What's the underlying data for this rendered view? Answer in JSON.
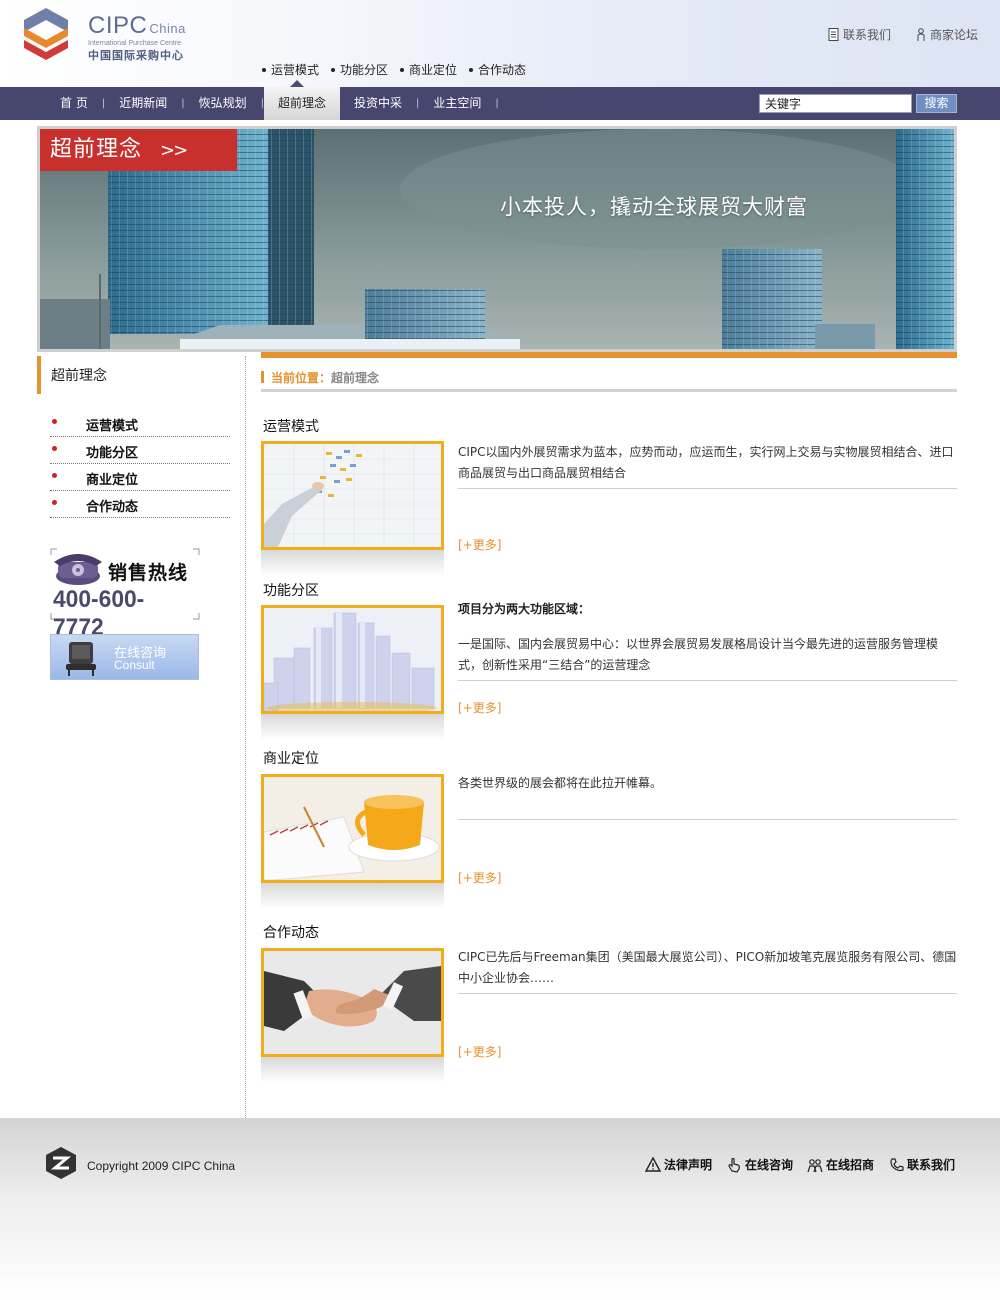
{
  "logo": {
    "brand": "CIPC",
    "brand_suffix": "China",
    "en_name": "International Purchase Centre",
    "cn_name": "中国国际采购中心"
  },
  "top_links": [
    {
      "label": "联系我们",
      "icon": "document-icon"
    },
    {
      "label": "商家论坛",
      "icon": "person-icon"
    }
  ],
  "subnav": [
    "运营模式",
    "功能分区",
    "商业定位",
    "合作动态"
  ],
  "nav": {
    "items": [
      "首 页",
      "近期新闻",
      "恢弘规划",
      "超前理念",
      "投资中采",
      "业主空间"
    ],
    "active_index": 3,
    "search_value": "关键字",
    "search_button": "搜索"
  },
  "banner": {
    "tag": "超前理念",
    "tag_arrows": ">>",
    "slogan": "小本投人，撬动全球展贸大财富"
  },
  "sidebar": {
    "title": "超前理念",
    "items": [
      "运营模式",
      "功能分区",
      "商业定位",
      "合作动态"
    ],
    "hotline_label": "销售热线",
    "hotline_number": "400-600-7772",
    "consult_cn": "在线咨询",
    "consult_en": "Consult"
  },
  "breadcrumb": {
    "label": "当前位置：",
    "current": "超前理念"
  },
  "sections": [
    {
      "title": "运营模式",
      "text": "CIPC以国内外展贸需求为蓝本，应势而动，应运而生，实行网上交易与实物展贸相结合、进口商品展贸与出口商品展贸相结合",
      "more": "[+更多]"
    },
    {
      "title": "功能分区",
      "lead": "项目分为两大功能区域：",
      "text": "一是国际、国内会展贸易中心：以世界会展贸易发展格局设计当今最先进的运营服务管理模式，创新性采用“三结合”的运营理念",
      "more": "[+更多]"
    },
    {
      "title": "商业定位",
      "text": "各类世界级的展会都将在此拉开帷幕。",
      "more": "[+更多]"
    },
    {
      "title": "合作动态",
      "text": "CIPC已先后与Freeman集团（美国最大展览公司）、PICO新加坡笔克展览服务有限公司、德国中小企业协会……",
      "more": "[+更多]"
    }
  ],
  "footer": {
    "copyright": "Copyright 2009  CIPC China",
    "links": [
      {
        "label": "法律声明",
        "icon": "warning-icon"
      },
      {
        "label": "在线咨询",
        "icon": "hand-pointer-icon"
      },
      {
        "label": "在线招商",
        "icon": "people-icon"
      },
      {
        "label": "联系我们",
        "icon": "phone-icon"
      }
    ]
  },
  "colors": {
    "nav_bg": "#46466e",
    "accent_orange": "#e4932e",
    "banner_red": "#c8302d",
    "img_border": "#f2ad1b"
  }
}
